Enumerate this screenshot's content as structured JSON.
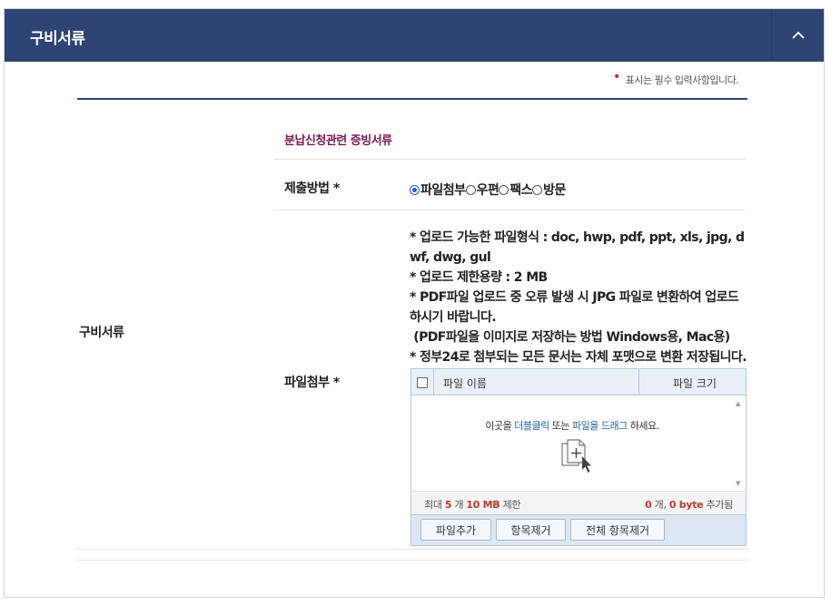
{
  "header": {
    "title": "구비서류"
  },
  "required_note": {
    "marker": "•",
    "text": "표시는 필수 입력사항입니다."
  },
  "left_label": "구비서류",
  "section_title": "분납신청관련 증빙서류",
  "method": {
    "label": "제출방법 *",
    "options": [
      {
        "label": "파일첨부",
        "selected": true
      },
      {
        "label": "우편",
        "selected": false
      },
      {
        "label": "팩스",
        "selected": false
      },
      {
        "label": "방문",
        "selected": false
      }
    ]
  },
  "attach": {
    "label": "파일첨부 *",
    "notes": [
      "* 업로드 가능한 파일형식 : doc, hwp, pdf, ppt, xls, jpg, dwf, dwg, gul",
      "* 업로드 제한용량 : 2 MB",
      "* PDF파일 업로드 중 오류 발생 시 JPG 파일로 변환하여 업로드 하시기 바랍니다.",
      " (PDF파일을 이미지로 저장하는 방법 Windows용, Mac용)",
      "* 정부24로 첨부되는 모든 문서는 자체 포맷으로 변환 저장됩니다."
    ]
  },
  "uploader": {
    "col_name": "파일 이름",
    "col_size": "파일 크기",
    "drop_prefix": "이곳을 ",
    "drop_hl1": "더블클릭",
    "drop_mid": " 또는 ",
    "drop_hl2": "파일을 드래그",
    "drop_suffix": " 하세요.",
    "limit_prefix": "최대 ",
    "limit_count": "5",
    "limit_mid": " 개 ",
    "limit_size": "10 MB",
    "limit_suffix": " 제한",
    "added_count": "0",
    "added_mid": " 개, ",
    "added_size": "0 byte",
    "added_suffix": " 추가됨",
    "buttons": {
      "add": "파일추가",
      "remove": "항목제거",
      "remove_all": "전체 항목제거"
    }
  },
  "colors": {
    "header_bg": "#2d4474",
    "section_title": "#7b1a55",
    "required_dot": "#e0142b",
    "limit_red": "#c0392b"
  }
}
